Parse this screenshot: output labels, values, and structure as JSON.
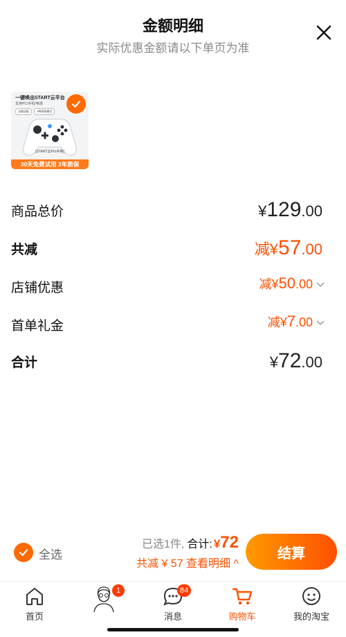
{
  "header": {
    "title": "金额明细",
    "subtitle": "实际优惠金额请以下单页为准"
  },
  "product": {
    "line1": "一键唤出START云平台",
    "line2": "支持PC/手机/电视",
    "tags": [
      "全能适配",
      "4种高效模式"
    ],
    "model": "[START云Pro手柄]",
    "banner": "30天免费试用 2年质保",
    "selected": true
  },
  "details": {
    "total_price": {
      "label": "商品总价",
      "yen": "¥",
      "int": "129",
      "dec": ".00"
    },
    "total_discount": {
      "label": "共减",
      "prefix": "减¥",
      "int": "57",
      "dec": ".00"
    },
    "store_discount": {
      "label": "店铺优惠",
      "prefix": "减¥",
      "int": "50",
      "dec": ".00"
    },
    "first_order_gift": {
      "label": "首单礼金",
      "prefix": "减¥",
      "int": "7",
      "dec": ".00"
    },
    "subtotal": {
      "label": "合计",
      "yen": "¥",
      "int": "72",
      "dec": ".00"
    }
  },
  "footer": {
    "select_all": "全选",
    "selected_count": "已选1件,",
    "total_label": "合计:",
    "total_yen": "¥",
    "total_value": "72",
    "discount_line": "共减 ¥ 57  查看明细 ^",
    "checkout": "结算"
  },
  "tabs": [
    {
      "label": "首页",
      "icon": "home-icon"
    },
    {
      "label": "",
      "icon": "avatar-sketch-icon",
      "badge": "1"
    },
    {
      "label": "消息",
      "icon": "message-icon",
      "badge": "84"
    },
    {
      "label": "购物车",
      "icon": "cart-icon",
      "active": true
    },
    {
      "label": "我的淘宝",
      "icon": "profile-icon"
    }
  ],
  "colors": {
    "accent": "#ff5000",
    "checkout_gradient_start": "#ff9a00",
    "checkout_gradient_end": "#ff4f00"
  }
}
